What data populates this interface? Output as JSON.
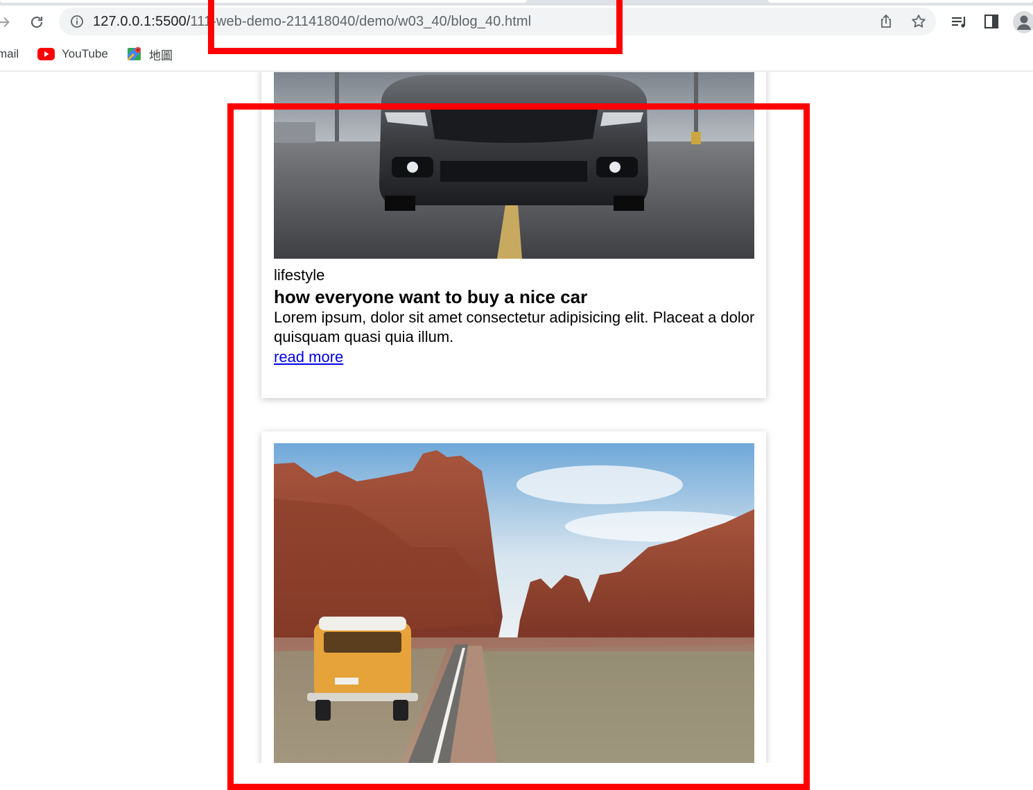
{
  "browser": {
    "url_host": "127.0.0.1:5500/",
    "url_path": "111-web-demo-211418040/demo/w03_40/blog_40.html",
    "bookmarks": [
      {
        "label": "mail",
        "icon": "gmail-icon"
      },
      {
        "label": "YouTube",
        "icon": "youtube-icon"
      },
      {
        "label": "地圖",
        "icon": "maps-icon"
      }
    ]
  },
  "posts": [
    {
      "image": "sports-car-image",
      "category": "lifestyle",
      "title": "how everyone want to buy a nice car",
      "excerpt": "Lorem ipsum, dolor sit amet consectetur adipisicing elit. Placeat a dolor quisquam quasi quia illum.",
      "link": "read more"
    },
    {
      "image": "desert-van-image"
    }
  ],
  "colors": {
    "annotation": "#ff0000",
    "link": "#0000ee",
    "omnibox": "#f1f3f4"
  }
}
